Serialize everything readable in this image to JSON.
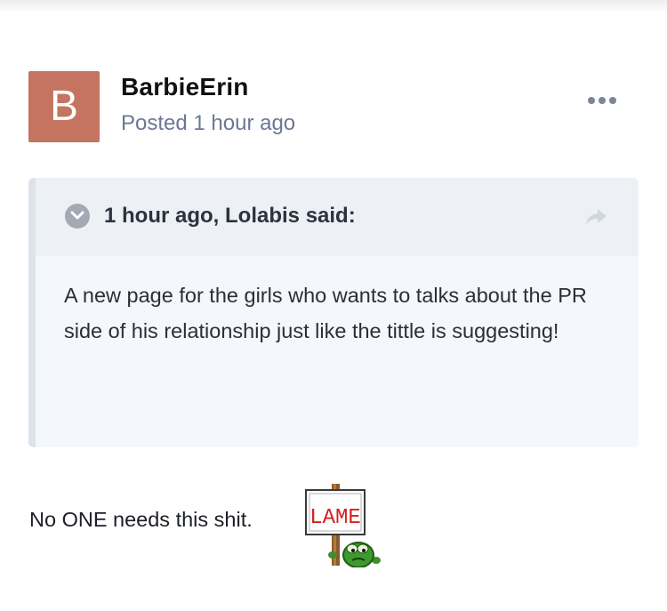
{
  "post": {
    "avatar_letter": "B",
    "author": "BarbieErin",
    "posted": "Posted 1 hour ago",
    "menu_icon": "ellipsis-icon"
  },
  "quote": {
    "citation": "1 hour ago, Lolabis said:",
    "body": "A new page for the girls who wants to talks about the PR side of his relationship just like the tittle is suggesting!",
    "toggle_icon": "chevron-down-circle-icon",
    "share_icon": "share-arrow-icon"
  },
  "content": {
    "text": "No ONE needs this shit.",
    "emoticon_sign": "LAME"
  },
  "colors": {
    "avatar": "#c47460",
    "meta": "#6b7894",
    "quote_bg": "#f4f7fb",
    "quote_head": "#edf1f5"
  }
}
